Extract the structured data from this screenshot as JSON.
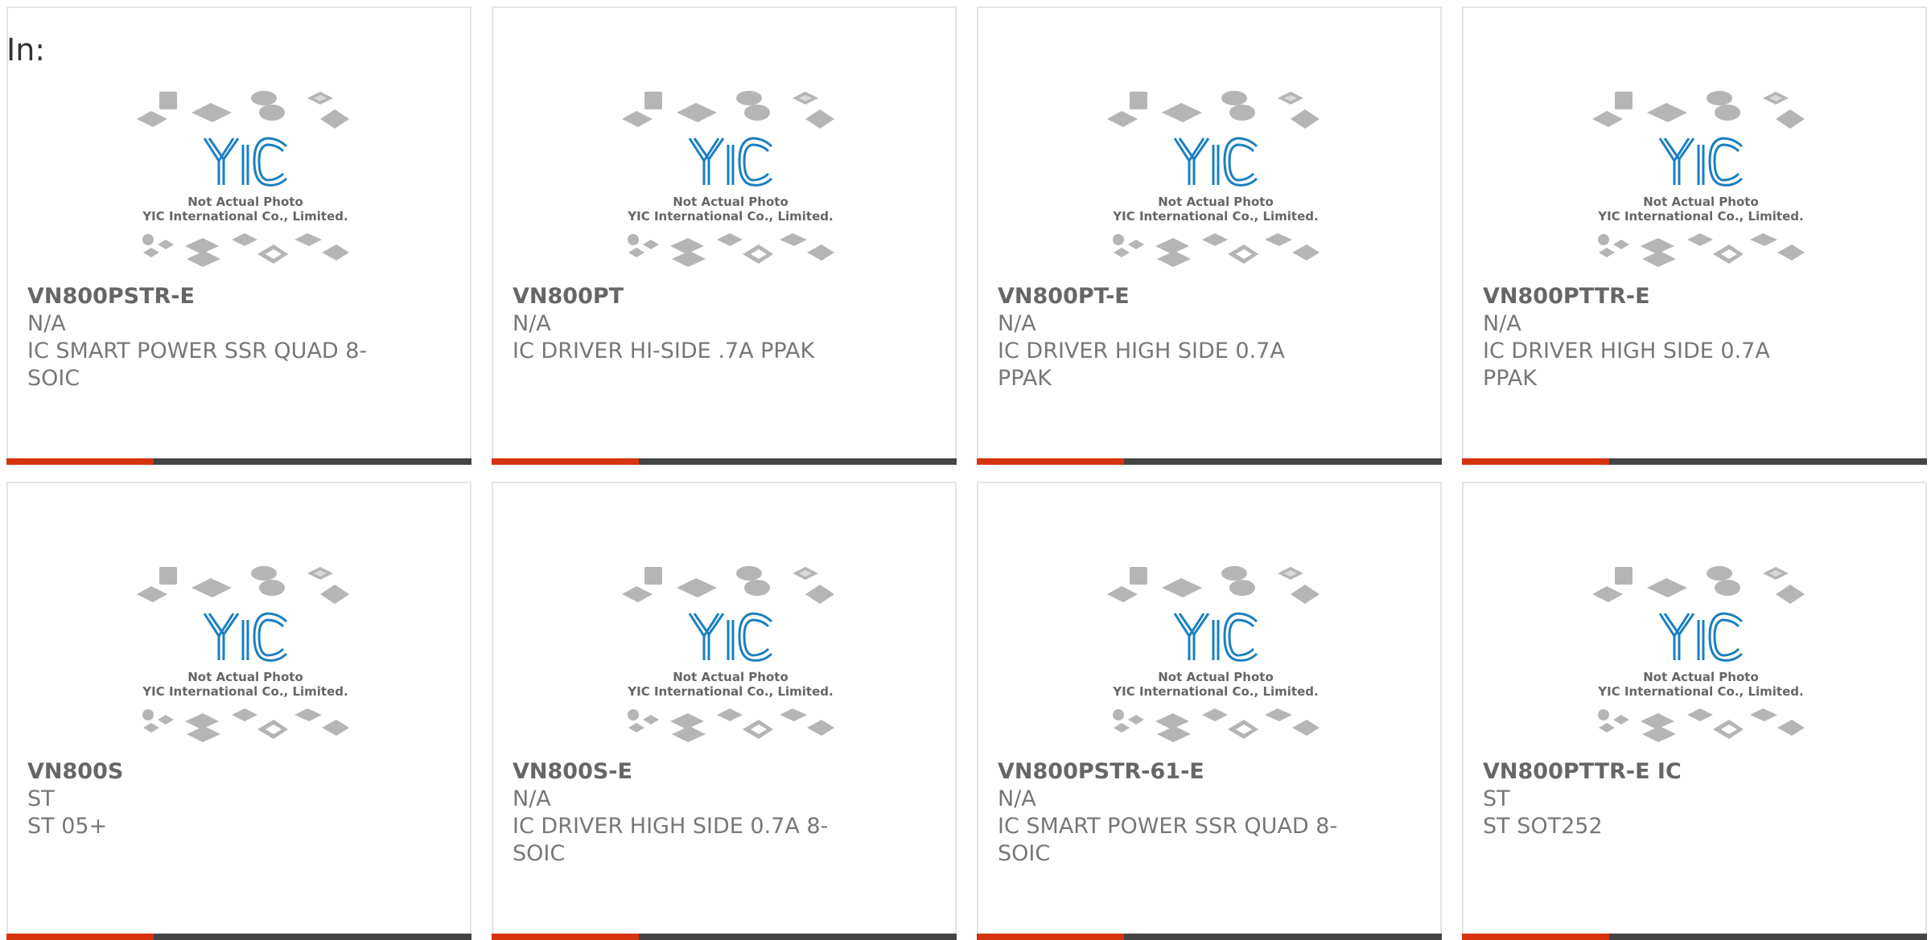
{
  "header": {
    "label": "In:"
  },
  "photo": {
    "caption_line1": "Not Actual Photo",
    "caption_line2": "YIC International Co., Limited.",
    "logo_text": "YIC"
  },
  "colors": {
    "accent": "#d5340f",
    "bar": "#444444",
    "logo": "#1a7fc1"
  },
  "products": [
    {
      "part": "VN800PSTR-E",
      "maker": "N/A",
      "desc": "IC SMART POWER SSR QUAD 8-SOIC"
    },
    {
      "part": "VN800PT",
      "maker": "N/A",
      "desc": "IC DRIVER HI-SIDE .7A PPAK"
    },
    {
      "part": "VN800PT-E",
      "maker": "N/A",
      "desc": "IC DRIVER HIGH SIDE 0.7A PPAK"
    },
    {
      "part": "VN800PTTR-E",
      "maker": "N/A",
      "desc": "IC DRIVER HIGH SIDE 0.7A PPAK"
    },
    {
      "part": "VN800S",
      "maker": "ST",
      "desc": "ST 05+"
    },
    {
      "part": "VN800S-E",
      "maker": "N/A",
      "desc": "IC DRIVER HIGH SIDE 0.7A 8-SOIC"
    },
    {
      "part": "VN800PSTR-61-E",
      "maker": "N/A",
      "desc": "IC SMART POWER SSR QUAD 8-SOIC"
    },
    {
      "part": "VN800PTTR-E IC",
      "maker": "ST",
      "desc": "ST SOT252"
    }
  ]
}
